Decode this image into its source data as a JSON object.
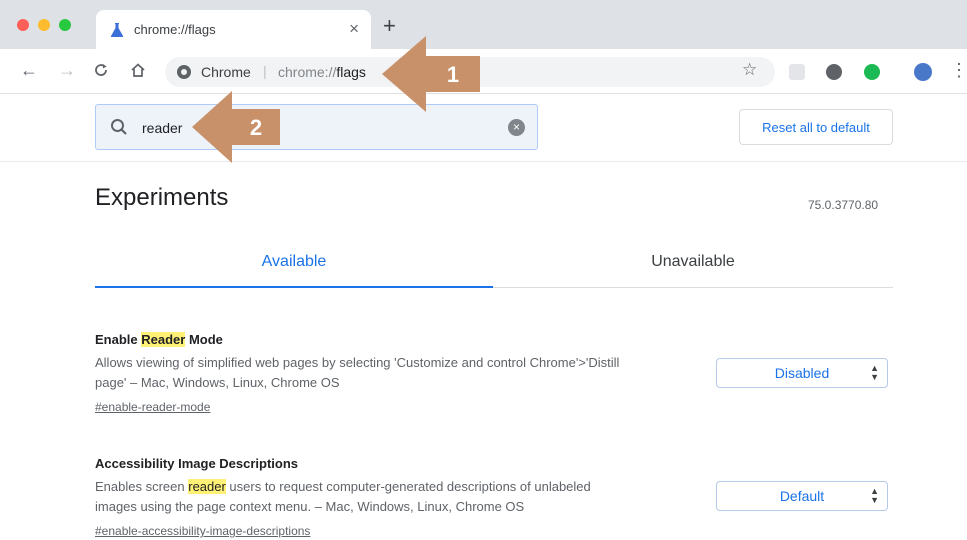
{
  "window": {
    "tab_title": "chrome://flags",
    "traffic_colors": [
      "#fe5f57",
      "#febc2e",
      "#28c840"
    ]
  },
  "toolbar": {
    "omnibox_site": "Chrome",
    "omnibox_separator": "|",
    "omnibox_url_prefix": "chrome://",
    "omnibox_url_path": "flags"
  },
  "flags": {
    "search_value": "reader",
    "reset_label": "Reset all to default"
  },
  "page": {
    "title": "Experiments",
    "version": "75.0.3770.80",
    "tabs": [
      {
        "label": "Available",
        "active": true
      },
      {
        "label": "Unavailable",
        "active": false
      }
    ]
  },
  "experiments": [
    {
      "title_before": "Enable ",
      "title_highlight": "Reader",
      "title_after": " Mode",
      "desc_line1": "Allows viewing of simplified web pages by selecting 'Customize and control Chrome'>'Distill",
      "desc_line2": "page' – Mac, Windows, Linux, Chrome OS",
      "link": "#enable-reader-mode",
      "value": "Disabled"
    },
    {
      "title": "Accessibility Image Descriptions",
      "desc_line1_before": "Enables screen ",
      "desc_line1_highlight": "reader",
      "desc_line1_after": " users to request computer-generated descriptions of unlabeled",
      "desc_line2": "images using the page context menu. – Mac, Windows, Linux, Chrome OS",
      "link": "#enable-accessibility-image-descriptions",
      "value": "Default"
    }
  ],
  "annotations": [
    {
      "label": "1",
      "color": "#c8916a"
    },
    {
      "label": "2",
      "color": "#c8916a"
    }
  ],
  "colors": {
    "accent": "#1a73e8",
    "highlight": "#fff176"
  }
}
